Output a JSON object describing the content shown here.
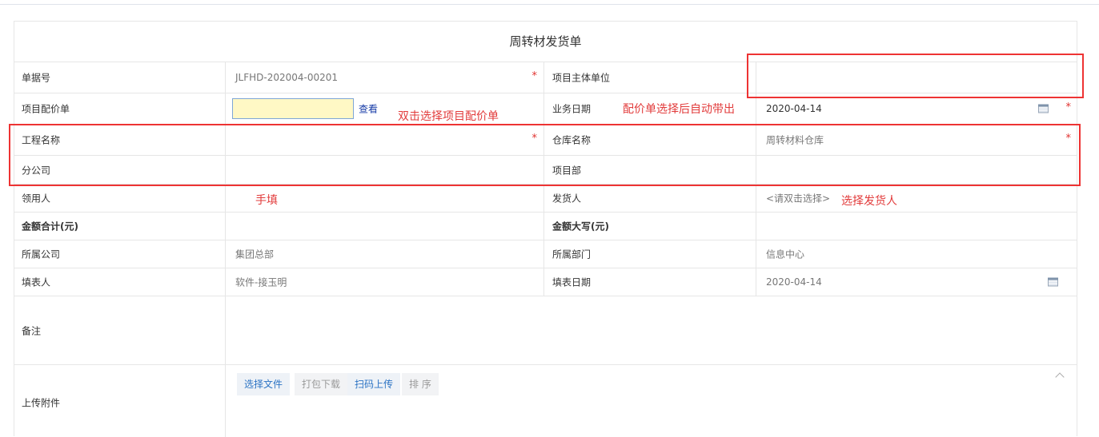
{
  "form": {
    "title": "周转材发货单",
    "rows": {
      "doc_no": {
        "label": "单据号",
        "value": "JLFHD-202004-00201",
        "label2": "项目主体单位",
        "value2": ""
      },
      "price_sheet": {
        "label": "项目配价单",
        "view_link": "查看",
        "label2": "业务日期",
        "value2": "2020-04-14"
      },
      "project": {
        "label": "工程名称",
        "value": "",
        "label2": "仓库名称",
        "value2": "周转材料仓库"
      },
      "branch": {
        "label": "分公司",
        "value": "",
        "label2": "项目部",
        "value2": ""
      },
      "receiver": {
        "label": "领用人",
        "value": "",
        "label2": "发货人",
        "value2": "<请双击选择>"
      },
      "amount": {
        "label": "金额合计(元)",
        "value": "",
        "label2": "金额大写(元)",
        "value2": ""
      },
      "company": {
        "label": "所属公司",
        "value": "集团总部",
        "label2": "所属部门",
        "value2": "信息中心"
      },
      "filler": {
        "label": "填表人",
        "value": "软件-接玉明",
        "label2": "填表日期",
        "value2": "2020-04-14"
      },
      "remark": {
        "label": "备注",
        "value": ""
      },
      "attachment": {
        "label": "上传附件"
      }
    },
    "required_mark": "*",
    "buttons": {
      "select_file": "选择文件",
      "pack_download": "打包下载",
      "scan_upload": "扫码上传",
      "sort": "排 序"
    }
  },
  "annotations": {
    "double_click": "双击选择项目配价单",
    "auto_fill": "配价单选择后自动带出",
    "manual": "手填",
    "choose_sender": "选择发货人"
  },
  "colors": {
    "annotation": "#e23b3b",
    "required": "#e0312f",
    "link": "#1a3ea8",
    "highlight_input": "#fff8c5"
  }
}
